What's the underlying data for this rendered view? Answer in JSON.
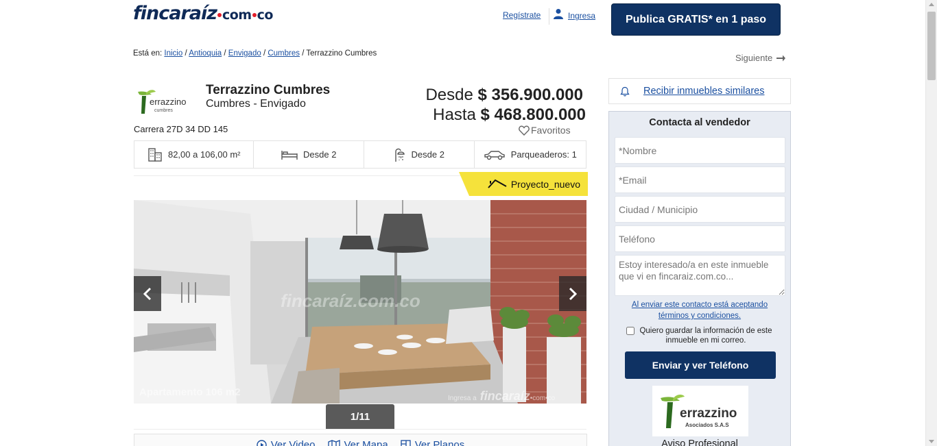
{
  "header": {
    "logo_main": "fincaraíz",
    "logo_com": "com",
    "logo_co": "co",
    "register": "Regístrate",
    "login": "Ingresa",
    "publish": "Publica GRATIS* en 1 paso"
  },
  "breadcrumb": {
    "prefix": "Está en:",
    "items": [
      "Inicio",
      "Antioquia",
      "Envigado",
      "Cumbres"
    ],
    "current": "Terrazzino Cumbres"
  },
  "next_label": "Siguiente",
  "property": {
    "title": "Terrazzino Cumbres",
    "subtitle": "Cumbres - Envigado",
    "address": "Carrera 27D 34 DD 145",
    "price_from_prefix": "Desde",
    "price_from": "$ 356.900.000",
    "price_to_prefix": "Hasta",
    "price_to": "$ 468.800.000",
    "favorites": "Favoritos",
    "logo_text": "errazzino",
    "logo_sub": "cumbres"
  },
  "features": {
    "area": "82,00 a 106,00 m²",
    "beds": "Desde  2",
    "baths": "Desde  2",
    "parking": "Parqueaderos: 1"
  },
  "badge": "Proyecto_nuevo",
  "gallery": {
    "caption": "Apartamento 106 m2",
    "watermark": "Ingresa a",
    "watermark_brand": "fincaraíz",
    "watermark_domain": "•com•co",
    "center_watermark": "fincaraíz.com.co",
    "counter": "1/11"
  },
  "media_links": [
    "Ver Video",
    "Ver Mapa",
    "Ver Planos"
  ],
  "sidebar": {
    "similar": "Recibir inmuebles similares",
    "contact_title": "Contacta al vendedor",
    "name_placeholder": "*Nombre",
    "email_placeholder": "*Email",
    "city_placeholder": "Ciudad / Municipio",
    "phone_placeholder": "Teléfono",
    "message_placeholder": "Estoy interesado/a en este inmueble que vi en fincaraiz.com.co...",
    "terms": "Al enviar este contacto está aceptando términos y condiciones.",
    "save_info": "Quiero guardar la información de este inmueble en mi correo.",
    "submit": "Enviar y ver Teléfono",
    "seller_logo_text": "errazzino",
    "seller_logo_sub": "Asociados S.A.S",
    "seller_type": "Aviso Profesional"
  },
  "colors": {
    "brand_navy": "#0f3263",
    "link_blue": "#1a4fa0",
    "badge_yellow": "#f5e23b",
    "logo_red": "#e31e2a",
    "panel_bg": "#e8ecf3"
  }
}
